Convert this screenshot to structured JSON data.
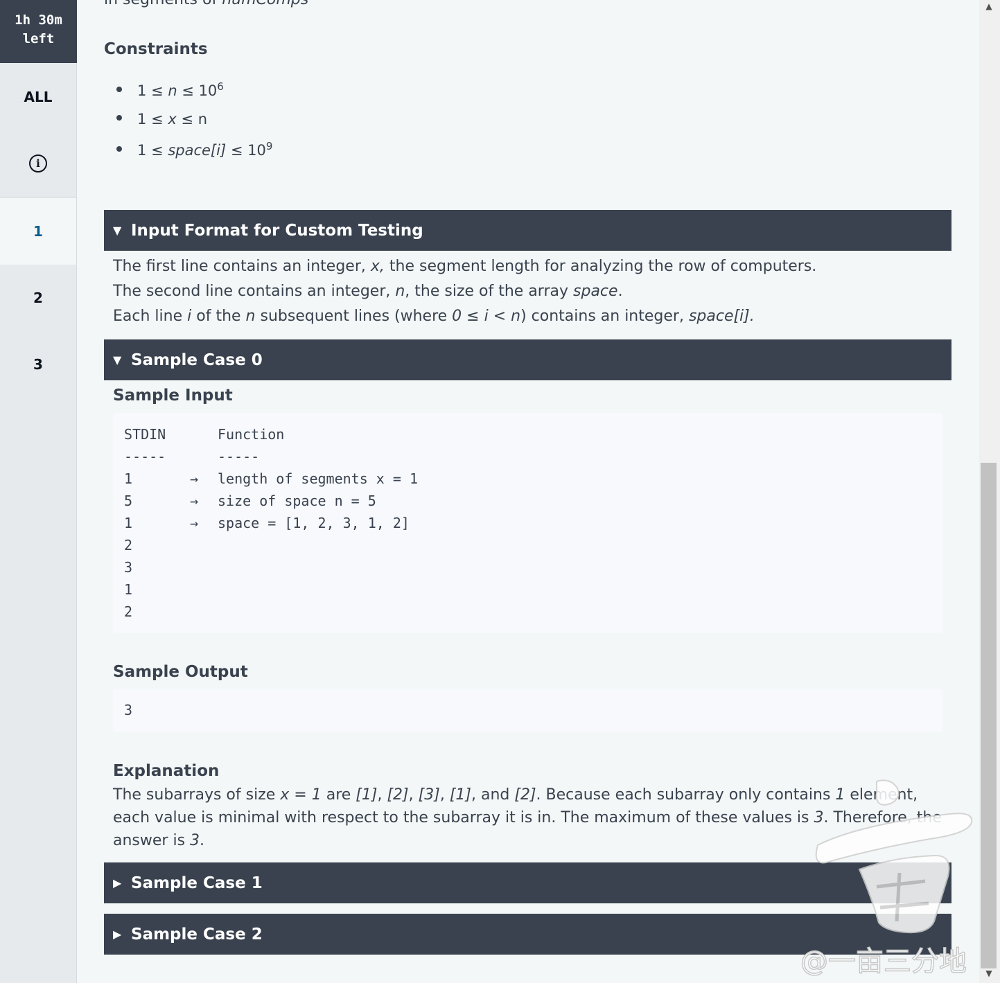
{
  "timer": {
    "line1": "1h 30m",
    "line2": "left"
  },
  "rail": {
    "all_label": "ALL",
    "questions": [
      "1",
      "2",
      "3"
    ]
  },
  "cut_text": {
    "prefix": "in segments of ",
    "italic": "numComps"
  },
  "constraints": {
    "heading": "Constraints",
    "items": [
      {
        "a": "1 ≤ ",
        "var": "n",
        "b": " ≤ 10",
        "sup": "6"
      },
      {
        "a": "1 ≤ ",
        "var": "x",
        "b": " ≤ n",
        "sup": ""
      },
      {
        "a": "1 ≤ ",
        "var": "space[i]",
        "b": " ≤ 10",
        "sup": "9"
      }
    ]
  },
  "input_format": {
    "title": "Input Format for Custom Testing",
    "line1": {
      "p1": "The first line contains an integer, ",
      "v1": "x,",
      "p2": " the segment length for analyzing the row of computers."
    },
    "line2": {
      "p1": "The second line contains an integer, ",
      "v1": "n",
      "p2": ", the size of the array ",
      "v2": "space",
      "p3": "."
    },
    "line3": {
      "p1": "Each line ",
      "v1": "i",
      "p2": " of the ",
      "v2": "n",
      "p3": " subsequent lines (where ",
      "v3": "0 ≤ i < n",
      "p4": ") contains an integer, ",
      "v4": "space[i]."
    }
  },
  "sample0": {
    "title": "Sample Case 0",
    "input_heading": "Sample Input",
    "input_lines": [
      {
        "c1": "STDIN",
        "c2": "",
        "c3": "Function"
      },
      {
        "c1": "-----",
        "c2": "",
        "c3": "-----"
      },
      {
        "c1": "1",
        "c2": "→",
        "c3": "length of segments x = 1"
      },
      {
        "c1": "5",
        "c2": "→",
        "c3": "size of space n = 5"
      },
      {
        "c1": "1",
        "c2": "→",
        "c3": "space = [1, 2, 3, 1, 2]"
      },
      {
        "c1": "2",
        "c2": "",
        "c3": ""
      },
      {
        "c1": "3",
        "c2": "",
        "c3": ""
      },
      {
        "c1": "1",
        "c2": "",
        "c3": ""
      },
      {
        "c1": "2",
        "c2": "",
        "c3": ""
      }
    ],
    "output_heading": "Sample Output",
    "output_value": "3",
    "explanation_heading": "Explanation",
    "explanation": {
      "t1": "The subarrays of size ",
      "v1": "x = 1",
      "t2": " are ",
      "v2": "[1]",
      "t3": ", ",
      "v3": "[2]",
      "t4": ", ",
      "v4": "[3]",
      "t5": ", ",
      "v5": "[1]",
      "t6": ", and ",
      "v6": "[2]",
      "t7": ". Because each subarray only contains ",
      "v7": "1",
      "t8": " element, each value is minimal with respect to the subarray it is in. The maximum of these values is ",
      "v8": "3",
      "t9": ". Therefore, the answer is ",
      "v9": "3",
      "t10": "."
    }
  },
  "sample1": {
    "title": "Sample Case 1"
  },
  "sample2": {
    "title": "Sample Case 2"
  },
  "watermark": {
    "text": "@一亩三分地"
  }
}
